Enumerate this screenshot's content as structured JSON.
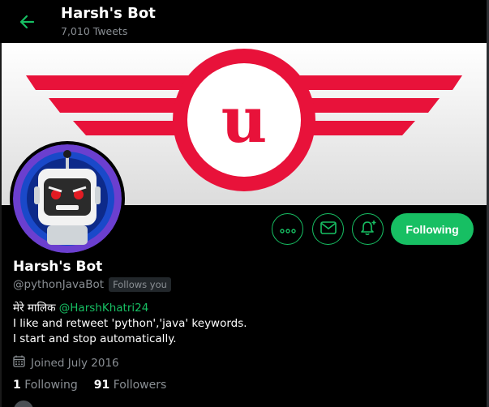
{
  "header": {
    "title": "Harsh's Bot",
    "subtitle": "7,010 Tweets",
    "back_icon": "back-arrow-icon"
  },
  "banner": {
    "logo_letter": "u",
    "logo_color": "#e8123a"
  },
  "actions": {
    "more_icon": "more-icon",
    "message_icon": "mail-icon",
    "notify_icon": "bell-plus-icon",
    "follow_label": "Following"
  },
  "profile": {
    "name": "Harsh's Bot",
    "handle": "@pythonJavaBot",
    "follows_you": "Follows you",
    "bio_prefix": "मेरे मालिक",
    "bio_mention": "@HarshKhatri24",
    "bio_line2": "I like and retweet 'python','java' keywords.",
    "bio_line3": "I start and stop automatically.",
    "joined": "Joined July 2016",
    "following_count": "1",
    "following_label": "Following",
    "followers_count": "91",
    "followers_label": "Followers"
  },
  "colors": {
    "accent": "#17bf63",
    "muted": "#8a8f94"
  }
}
